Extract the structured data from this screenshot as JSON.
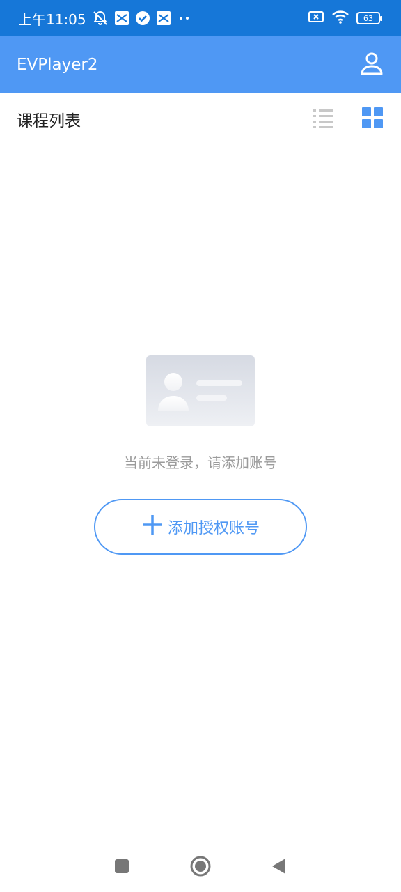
{
  "status_bar": {
    "time": "上午11:05",
    "battery": "63",
    "background_color": "#1677d8",
    "icons": [
      "notifications-off-icon",
      "app-notification-icon",
      "check-circle-icon",
      "app-notification-icon",
      "more-dots-icon",
      "sim-missing-icon",
      "wifi-icon",
      "battery-icon"
    ]
  },
  "app_bar": {
    "title": "EVPlayer2",
    "profile_icon": "user-icon",
    "background_color": "#4f98f4"
  },
  "section": {
    "title": "课程列表",
    "list_view_icon": "list-view-icon",
    "grid_view_icon": "grid-view-icon",
    "active_view": "grid"
  },
  "empty_state": {
    "illustration": "id-card-illustration",
    "message": "当前未登录，请添加账号",
    "button_label": "添加授权账号",
    "button_icon": "plus-icon",
    "accent_color": "#4f98f4"
  },
  "nav_bar": {
    "icons": [
      "recent-apps-icon",
      "home-icon",
      "back-icon"
    ]
  }
}
